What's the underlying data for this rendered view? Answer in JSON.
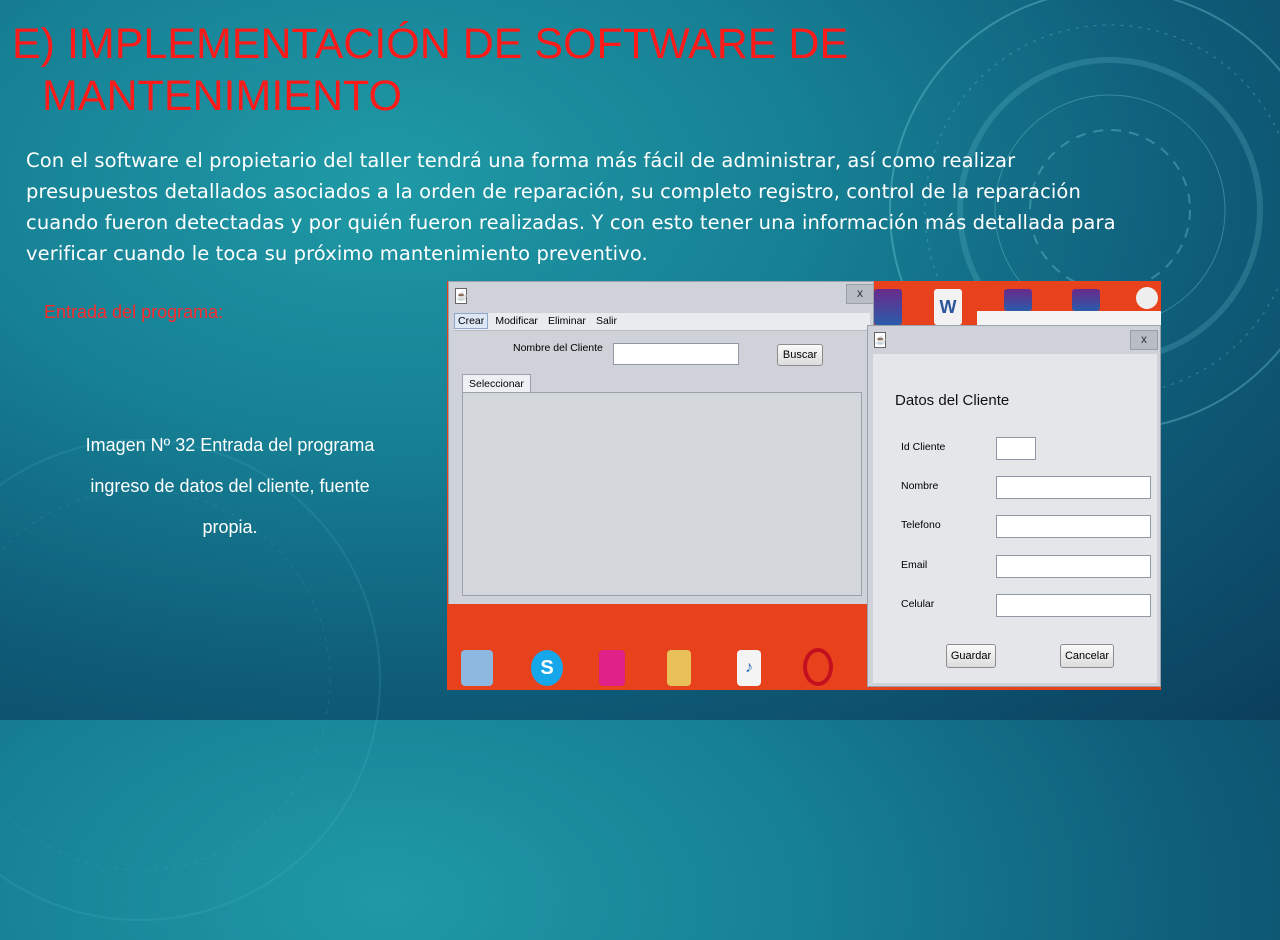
{
  "slide": {
    "title_line1": "E) IMPLEMENTACIÓN DE SOFTWARE DE",
    "title_line2": "MANTENIMIENTO",
    "body": "Con el software el propietario del taller tendrá una forma más fácil de administrar, así como realizar presupuestos detallados asociados a la orden de reparación, su completo registro, control de la reparación cuando fueron detectadas y por quién fueron realizadas. Y con esto tener una información más detallada para verificar cuando le toca su próximo mantenimiento preventivo.",
    "subheading": "Entrada del programa:",
    "caption": "Imagen Nº 32 Entrada del programa ingreso de datos del cliente, fuente propia."
  },
  "main_window": {
    "close": "x",
    "menu": [
      "Crear",
      "Modificar",
      "Eliminar",
      "Salir"
    ],
    "search_label": "Nombre del Cliente",
    "search_value": "",
    "search_button": "Buscar",
    "tab": "Seleccionar"
  },
  "dialog": {
    "close": "x",
    "heading": "Datos del Cliente",
    "fields": [
      {
        "label": "Id Cliente",
        "value": ""
      },
      {
        "label": "Nombre",
        "value": ""
      },
      {
        "label": "Telefono",
        "value": ""
      },
      {
        "label": "Email",
        "value": ""
      },
      {
        "label": "Celular",
        "value": ""
      }
    ],
    "save_button": "Guardar",
    "cancel_button": "Cancelar"
  },
  "colors": {
    "title": "#ff1a1a",
    "desktop": "#e8421c",
    "window": "#cfd2d8"
  }
}
